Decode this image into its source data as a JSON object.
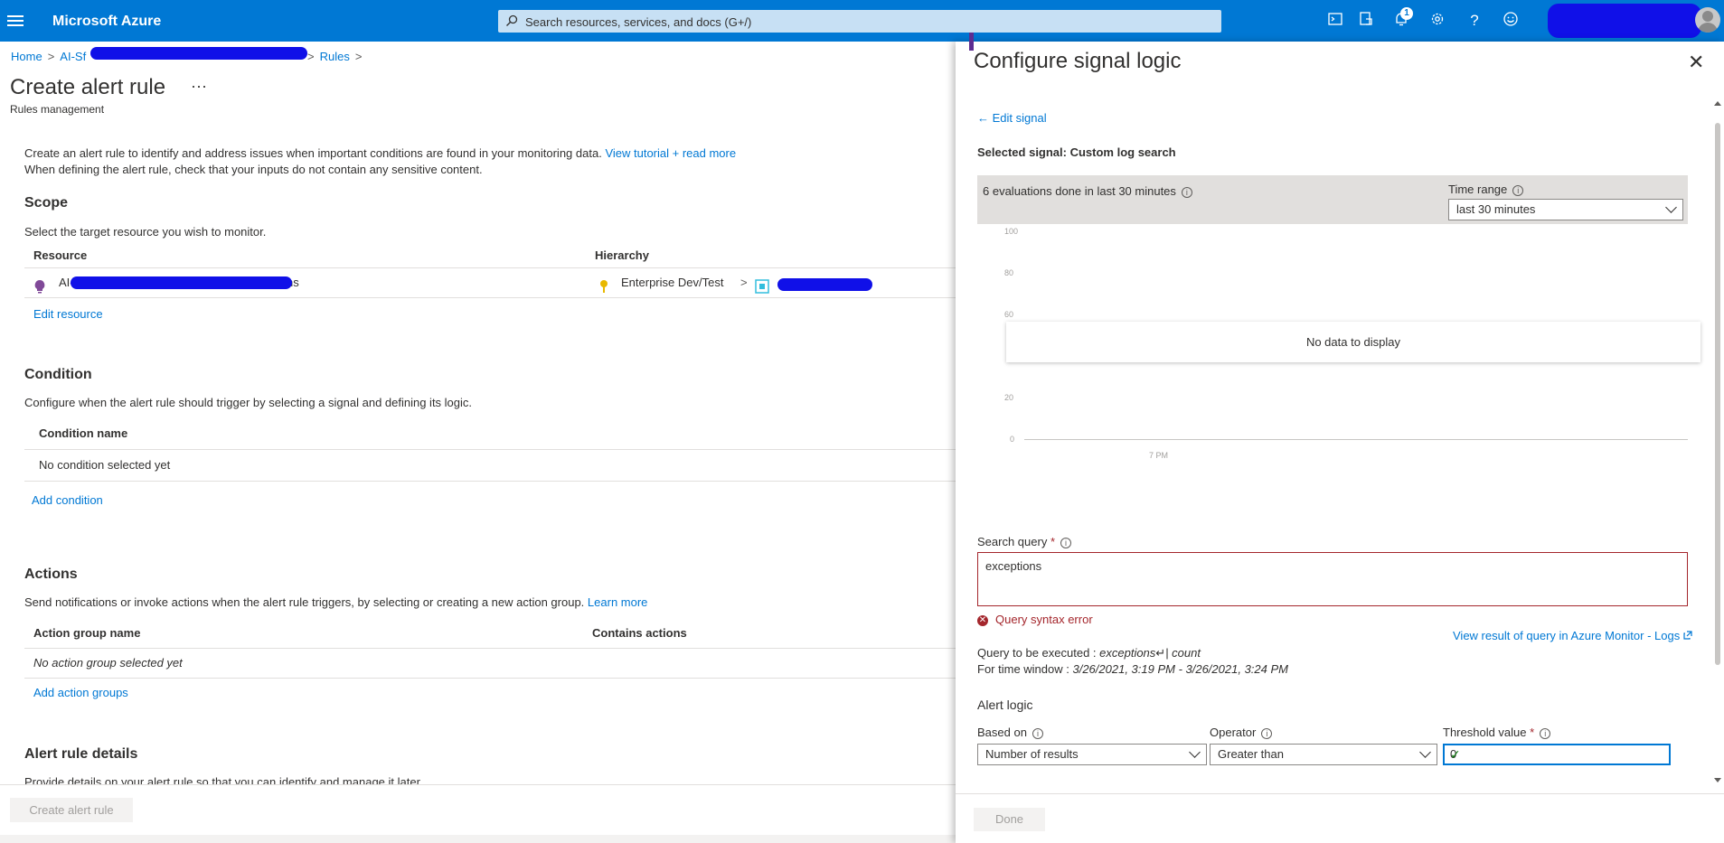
{
  "topbar": {
    "brand": "Microsoft Azure",
    "search_placeholder": "Search resources, services, and docs (G+/)",
    "notifications_count": "1",
    "icons": [
      "cloud-shell-icon",
      "directory-filter-icon",
      "notifications-icon",
      "settings-icon",
      "help-icon",
      "feedback-icon"
    ],
    "accent_color": "#0078d4"
  },
  "breadcrumb": {
    "home": "Home",
    "resource": "AI-Sf",
    "rules": "Rules"
  },
  "page": {
    "title": "Create alert rule",
    "more": "···",
    "subtitle": "Rules management",
    "intro_line1": "Create an alert rule to identify and address issues when important conditions are found in your monitoring data.",
    "intro_link": "View tutorial + read more",
    "intro_line2": "When defining the alert rule, check that your inputs do not contain any sensitive content."
  },
  "scope": {
    "heading": "Scope",
    "description": "Select the target resource you wish to monitor.",
    "col_resource": "Resource",
    "col_hierarchy": "Hierarchy",
    "resource_name": "AI-",
    "resource_suffix": "ns",
    "hierarchy_root": "Enterprise Dev/Test",
    "edit_link": "Edit resource"
  },
  "condition": {
    "heading": "Condition",
    "description": "Configure when the alert rule should trigger by selecting a signal and defining its logic.",
    "col_name": "Condition name",
    "empty": "No condition selected yet",
    "add_link": "Add condition"
  },
  "actions": {
    "heading": "Actions",
    "description": "Send notifications or invoke actions when the alert rule triggers, by selecting or creating a new action group.",
    "learn_more": "Learn more",
    "col_group": "Action group name",
    "col_contains": "Contains actions",
    "empty": "No action group selected yet",
    "add_link": "Add action groups"
  },
  "details": {
    "heading": "Alert rule details",
    "description": "Provide details on your alert rule so that you can identify and manage it later."
  },
  "footer": {
    "create_button": "Create alert rule"
  },
  "panel": {
    "title": "Configure signal logic",
    "close": "✕",
    "edit_signal": "← Edit signal",
    "selected_signal": "Selected signal: Custom log search",
    "evaluations": "6 evaluations done in last 30 minutes",
    "time_range_label": "Time range",
    "time_range_value": "last 30 minutes",
    "chart": {
      "y_ticks": [
        "100",
        "80",
        "60",
        "20",
        "0"
      ],
      "x_tick": "7 PM",
      "no_data": "No data to display"
    },
    "search_query_label": "Search query",
    "required_mark": "*",
    "search_query_value": "exceptions",
    "error_text": "Query syntax error",
    "view_result_link": "View result of query in Azure Monitor - Logs",
    "query_exec_label": "Query to be executed : ",
    "query_exec_value": "exceptions↵| count",
    "time_window_label": "For time window : ",
    "time_window_value": "3/26/2021, 3:19 PM - 3/26/2021, 3:24 PM",
    "alert_logic_heading": "Alert logic",
    "based_on_label": "Based on",
    "based_on_value": "Number of results",
    "operator_label": "Operator",
    "operator_value": "Greater than",
    "threshold_label": "Threshold value",
    "threshold_value": "0",
    "done_button": "Done"
  }
}
